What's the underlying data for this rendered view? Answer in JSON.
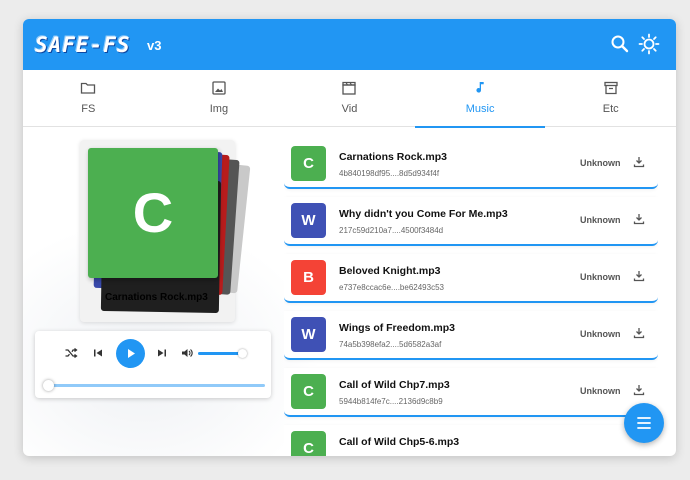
{
  "app": {
    "logo": "SAFE-FS",
    "version": "v3"
  },
  "appbar": {
    "search_icon": "search-icon",
    "theme_icon": "brightness-icon"
  },
  "tabs": [
    {
      "label": "FS",
      "icon": "folder-icon",
      "active": false
    },
    {
      "label": "Img",
      "icon": "image-icon",
      "active": false
    },
    {
      "label": "Vid",
      "icon": "clapperboard-icon",
      "active": false
    },
    {
      "label": "Music",
      "icon": "music-note-icon",
      "active": true
    },
    {
      "label": "Etc",
      "icon": "archive-icon",
      "active": false
    }
  ],
  "now_playing": {
    "letter": "C",
    "title": "Carnations Rock.mp3",
    "color": "#4caf50"
  },
  "player": {
    "volume": 0.85,
    "progress": 0.0
  },
  "files": [
    {
      "letter": "C",
      "name": "Carnations Rock.mp3",
      "hash": "4b840198df95....8d5d934f4f",
      "status": "Unknown",
      "color": "#4caf50"
    },
    {
      "letter": "W",
      "name": "Why didn't you Come For Me.mp3",
      "hash": "217c59d210a7....4500f3484d",
      "status": "Unknown",
      "color": "#3f51b5"
    },
    {
      "letter": "B",
      "name": "Beloved Knight.mp3",
      "hash": "e737e8ccac6e....be62493c53",
      "status": "Unknown",
      "color": "#f44336"
    },
    {
      "letter": "W",
      "name": "Wings of Freedom.mp3",
      "hash": "74a5b398efa2....5d6582a3af",
      "status": "Unknown",
      "color": "#3f51b5"
    },
    {
      "letter": "C",
      "name": "Call of Wild Chp7.mp3",
      "hash": "5944b814fe7c....2136d9c8b9",
      "status": "Unknown",
      "color": "#4caf50"
    },
    {
      "letter": "C",
      "name": "Call of Wild Chp5-6.mp3",
      "hash": "",
      "status": "",
      "color": "#4caf50"
    }
  ],
  "colors": {
    "accent": "#2196f3",
    "background": "#ececec"
  }
}
